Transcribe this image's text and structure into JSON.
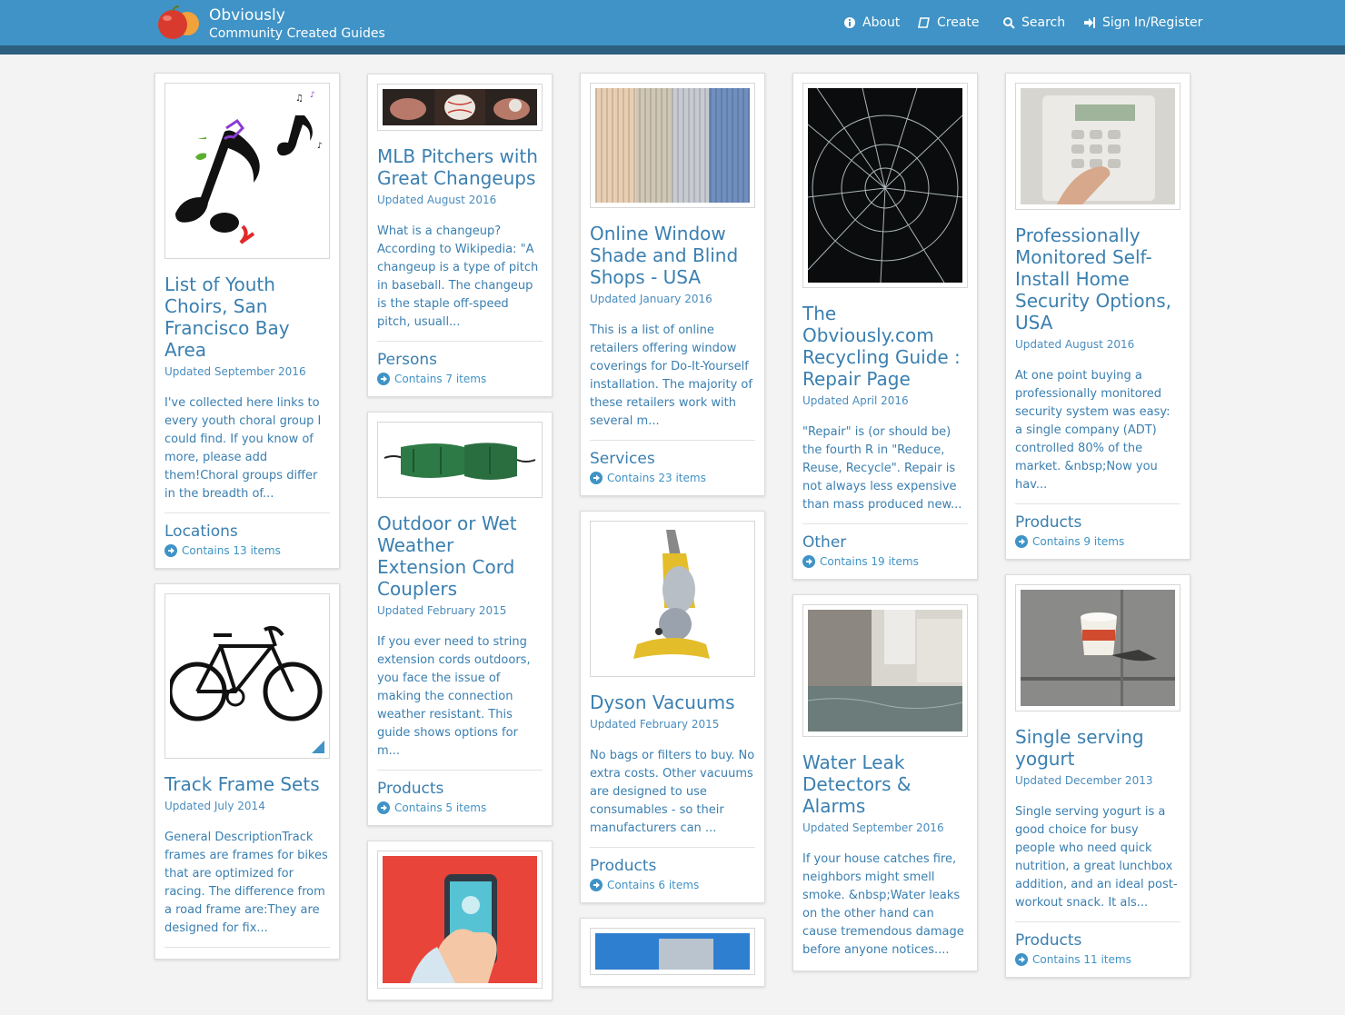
{
  "brand": {
    "name": "Obviously",
    "tagline": "Community Created Guides"
  },
  "nav": {
    "about": "About",
    "create": "Create",
    "search": "Search",
    "signin": "Sign In/Register"
  },
  "cards": {
    "youth_choirs": {
      "title": "List of Youth Choirs, San Francisco Bay Area",
      "updated": "Updated September 2016",
      "desc": "I've collected here links to every youth choral group I could find. If you know of more, please add them!Choral groups differ in the breadth of...",
      "category": "Locations",
      "contains": "Contains 13 items"
    },
    "track_frames": {
      "title": "Track Frame Sets",
      "updated": "Updated July 2014",
      "desc": "General DescriptionTrack frames are frames for bikes that are optimized for racing.  The difference from a road frame are:They are designed for fix..."
    },
    "mlb_pitchers": {
      "title": "MLB Pitchers with Great Changeups",
      "updated": "Updated August 2016",
      "desc": "What is a changeup? According to Wikipedia: \"A changeup is a type of pitch in baseball. The changeup is the staple off-speed pitch, usuall...",
      "category": "Persons",
      "contains": "Contains 7 items"
    },
    "extension_cord": {
      "title": "Outdoor or Wet Weather Extension Cord Couplers",
      "updated": "Updated February 2015",
      "desc": "If you ever need to string extension cords outdoors, you face the issue of making the connection weather resistant.  This guide shows options for m...",
      "category": "Products",
      "contains": "Contains 5 items"
    },
    "window_shades": {
      "title": "Online Window Shade and Blind Shops - USA",
      "updated": "Updated January 2016",
      "desc": "This is a list of online retailers offering window coverings for Do-It-Yourself installation.  The majority of these retailers work with several m...",
      "category": "Services",
      "contains": "Contains 23 items"
    },
    "dyson": {
      "title": "Dyson Vacuums",
      "updated": "Updated February 2015",
      "desc": "No bags or filters to buy. No extra costs. Other vacuums are designed to use consumables - so their manufacturers can ...",
      "category": "Products",
      "contains": "Contains 6 items"
    },
    "recycling": {
      "title": "The Obviously.com Recycling Guide : Repair Page",
      "updated": "Updated April 2016",
      "desc": "\"Repair\" is (or should be) the fourth R in \"Reduce, Reuse, Recycle\". Repair is not always less expensive than mass produced new...",
      "category": "Other",
      "contains": "Contains 19 items"
    },
    "water_leak": {
      "title": "Water Leak Detectors & Alarms",
      "updated": "Updated September 2016",
      "desc": "If your house catches fire, neighbors might smell smoke. &nbsp;Water leaks on the other hand can cause tremendous damage before anyone notices...."
    },
    "home_security": {
      "title": "Professionally Monitored Self-Install Home Security Options, USA",
      "updated": "Updated August 2016",
      "desc": "At one point buying a professionally monitored security system was easy: a single company (ADT) controlled 80% of the market. &nbsp;Now you hav...",
      "category": "Products",
      "contains": "Contains 9 items"
    },
    "yogurt": {
      "title": "Single serving yogurt",
      "updated": "Updated December 2013",
      "desc": "Single serving yogurt is a good choice for busy people who need quick nutrition, a great lunchbox addition, and an ideal post-workout snack. It als...",
      "category": "Products",
      "contains": "Contains 11 items"
    }
  },
  "colors": {
    "header": "#3f93c6",
    "header_stripe": "#2c5f80",
    "link": "#3a7fb0"
  }
}
